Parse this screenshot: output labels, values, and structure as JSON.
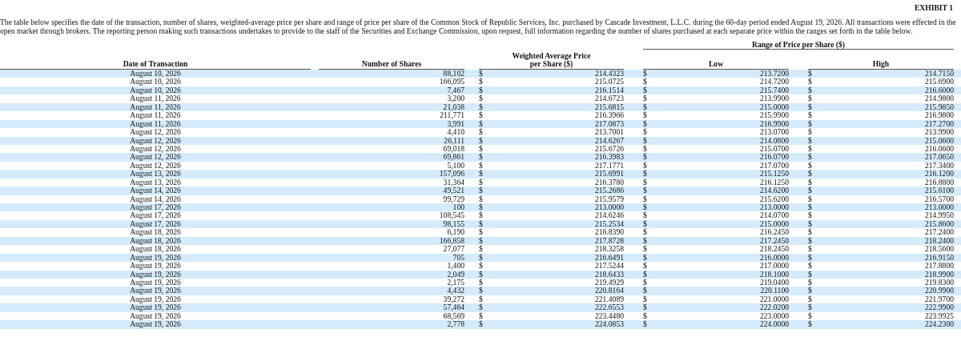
{
  "exhibit_label": "EXHIBIT 1",
  "intro": "The table below specifies the date of the transaction, number of shares, weighted-average price per share and range of price per share of the Common Stock of Republic Services, Inc. purchased by Cascade Investment, L.L.C. during the 60-day period ended August 19, 2026. All transactions were effected in the open market through brokers. The reporting person making such transactions undertakes to provide to the staff of the Securities and Exchange Commission, upon request, full information regarding the number of shares purchased at each separate price within the ranges set forth in the table below.",
  "table": {
    "group_header": "Range of Price per Share ($)",
    "columns": [
      "Date of Transaction",
      "Number of Shares",
      "Weighted Average Price per Share ($)",
      "Low",
      "High"
    ],
    "rows": [
      [
        "August 10, 2026",
        "88,102",
        "$",
        "214.4323",
        "$",
        "213.7200",
        "$",
        "214.7150"
      ],
      [
        "August 10, 2026",
        "166,095",
        "$",
        "215.0725",
        "$",
        "214.7200",
        "$",
        "215.6900"
      ],
      [
        "August 10, 2026",
        "7,467",
        "$",
        "216.1514",
        "$",
        "215.7400",
        "$",
        "216.6000"
      ],
      [
        "August 11, 2026",
        "3,200",
        "$",
        "214.6723",
        "$",
        "213.9900",
        "$",
        "214.9800"
      ],
      [
        "August 11, 2026",
        "21,038",
        "$",
        "215.6815",
        "$",
        "215.0000",
        "$",
        "215.9850"
      ],
      [
        "August 11, 2026",
        "211,771",
        "$",
        "216.3966",
        "$",
        "215.9900",
        "$",
        "216.9800"
      ],
      [
        "August 11, 2026",
        "3,991",
        "$",
        "217.0873",
        "$",
        "216.9900",
        "$",
        "217.2700"
      ],
      [
        "August 12, 2026",
        "4,410",
        "$",
        "213.7001",
        "$",
        "213.0700",
        "$",
        "213.9900"
      ],
      [
        "August 12, 2026",
        "26,111",
        "$",
        "214.6267",
        "$",
        "214.0800",
        "$",
        "215.0600"
      ],
      [
        "August 12, 2026",
        "69,018",
        "$",
        "215.6726",
        "$",
        "215.0700",
        "$",
        "216.0600"
      ],
      [
        "August 12, 2026",
        "69,861",
        "$",
        "216.3983",
        "$",
        "216.0700",
        "$",
        "217.0650"
      ],
      [
        "August 12, 2026",
        "5,100",
        "$",
        "217.1771",
        "$",
        "217.0700",
        "$",
        "217.3400"
      ],
      [
        "August 13, 2026",
        "157,096",
        "$",
        "215.6991",
        "$",
        "215.1250",
        "$",
        "216.1200"
      ],
      [
        "August 13, 2026",
        "31,364",
        "$",
        "216.3780",
        "$",
        "216.1250",
        "$",
        "216.8800"
      ],
      [
        "August 14, 2026",
        "49,521",
        "$",
        "215.2686",
        "$",
        "214.6200",
        "$",
        "215.6100"
      ],
      [
        "August 14, 2026",
        "99,729",
        "$",
        "215.9579",
        "$",
        "215.6200",
        "$",
        "216.5700"
      ],
      [
        "August 17, 2026",
        "100",
        "$",
        "213.0000",
        "$",
        "213.0000",
        "$",
        "213.0000"
      ],
      [
        "August 17, 2026",
        "108,545",
        "$",
        "214.6246",
        "$",
        "214.0700",
        "$",
        "214.9950"
      ],
      [
        "August 17, 2026",
        "98,155",
        "$",
        "215.2534",
        "$",
        "215.0000",
        "$",
        "215.8600"
      ],
      [
        "August 18, 2026",
        "6,190",
        "$",
        "216.8390",
        "$",
        "216.2450",
        "$",
        "217.2400"
      ],
      [
        "August 18, 2026",
        "166,858",
        "$",
        "217.8728",
        "$",
        "217.2450",
        "$",
        "218.2400"
      ],
      [
        "August 18, 2026",
        "27,077",
        "$",
        "218.3258",
        "$",
        "218.2450",
        "$",
        "218.5600"
      ],
      [
        "August 19, 2026",
        "705",
        "$",
        "216.6491",
        "$",
        "216.0000",
        "$",
        "216.9150"
      ],
      [
        "August 19, 2026",
        "1,400",
        "$",
        "217.5244",
        "$",
        "217.0000",
        "$",
        "217.8800"
      ],
      [
        "August 19, 2026",
        "2,049",
        "$",
        "218.6433",
        "$",
        "218.1000",
        "$",
        "218.9900"
      ],
      [
        "August 19, 2026",
        "2,175",
        "$",
        "219.4929",
        "$",
        "219.0400",
        "$",
        "219.8300"
      ],
      [
        "August 19, 2026",
        "4,432",
        "$",
        "220.8164",
        "$",
        "220.1100",
        "$",
        "220.9900"
      ],
      [
        "August 19, 2026",
        "39,272",
        "$",
        "221.4089",
        "$",
        "221.0000",
        "$",
        "221.9700"
      ],
      [
        "August 19, 2026",
        "57,464",
        "$",
        "222.6553",
        "$",
        "222.0200",
        "$",
        "222.9900"
      ],
      [
        "August 19, 2026",
        "68,569",
        "$",
        "223.4480",
        "$",
        "223.0000",
        "$",
        "223.9925"
      ],
      [
        "August 19, 2026",
        "2,778",
        "$",
        "224.0853",
        "$",
        "224.0000",
        "$",
        "224.2300"
      ]
    ]
  }
}
